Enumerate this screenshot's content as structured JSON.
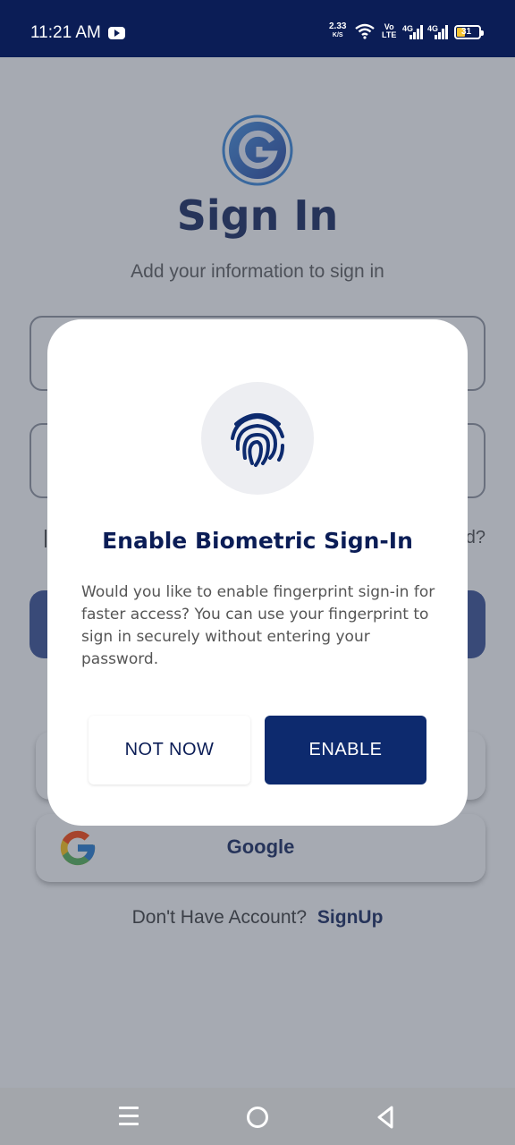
{
  "status_bar": {
    "time": "11:21 AM",
    "net_speed": "2.33",
    "net_unit": "K/S",
    "volte_top": "Vo",
    "volte_bottom": "LTE",
    "sig1_label": "4G",
    "sig2_label": "4G",
    "battery_level": "31"
  },
  "signin_page": {
    "title": "Sign In",
    "subtitle": "Add your information to sign in",
    "forgot_fragment": "d?",
    "google_label": "Google",
    "signup_prompt": "Don't Have Account?",
    "signup_link": "SignUp"
  },
  "dialog": {
    "title": "Enable Biometric Sign-In",
    "message": "Would you like to enable fingerprint sign-in for faster access? You can use your fingerprint to sign in securely without entering your password.",
    "not_now_label": "NOT NOW",
    "enable_label": "ENABLE"
  },
  "colors": {
    "brand_navy": "#0b1d56",
    "enable_button": "#0d2a6e",
    "overlay": "rgba(70,78,95,0.48)"
  },
  "icons": [
    "youtube-icon",
    "wifi-icon",
    "signal-icon",
    "battery-icon",
    "app-logo-icon",
    "fingerprint-icon",
    "google-icon",
    "menu-icon",
    "home-icon",
    "back-icon"
  ]
}
